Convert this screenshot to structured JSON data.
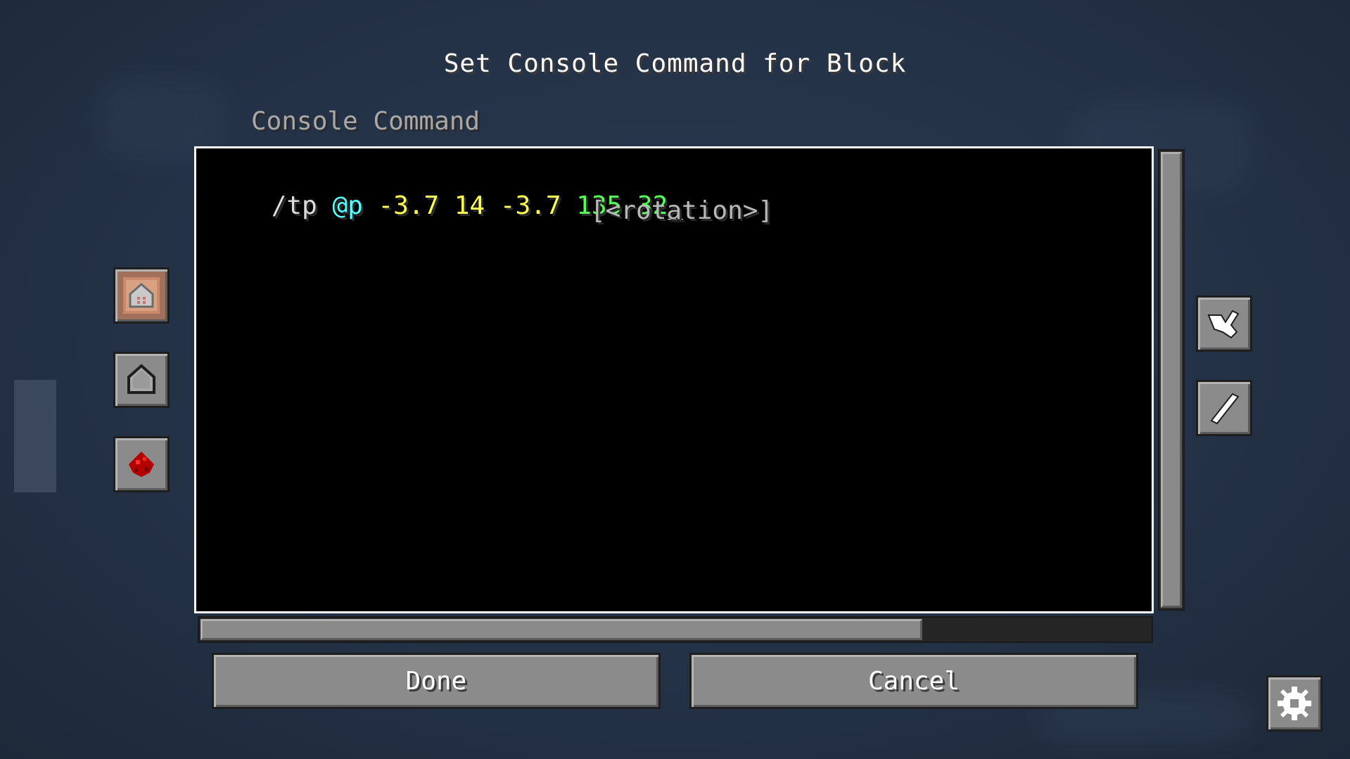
{
  "dialog": {
    "title": "Set Console Command for Block",
    "field_label": "Console Command"
  },
  "command": {
    "tokens": [
      {
        "text": "/tp ",
        "color": "#dcdcdc"
      },
      {
        "text": "@p",
        "color": "#55ffff"
      },
      {
        "text": " -3.7 14 -3.7 ",
        "color": "#ffff55"
      },
      {
        "text": "135 32",
        "color": "#55ff55"
      },
      {
        "text": "_",
        "color": "#dcdcdc"
      }
    ],
    "suggestion_hint": "[<rotation>]"
  },
  "scroll": {
    "horizontal_fraction": 0.76
  },
  "buttons": {
    "done": "Done",
    "cancel": "Cancel"
  },
  "left_icons": [
    "command-block-impulse-icon",
    "command-block-chain-icon",
    "redstone-dust-icon"
  ],
  "right_icons": [
    "trigger-mode-icon",
    "wand-icon"
  ],
  "corner_icon": "gear-icon"
}
